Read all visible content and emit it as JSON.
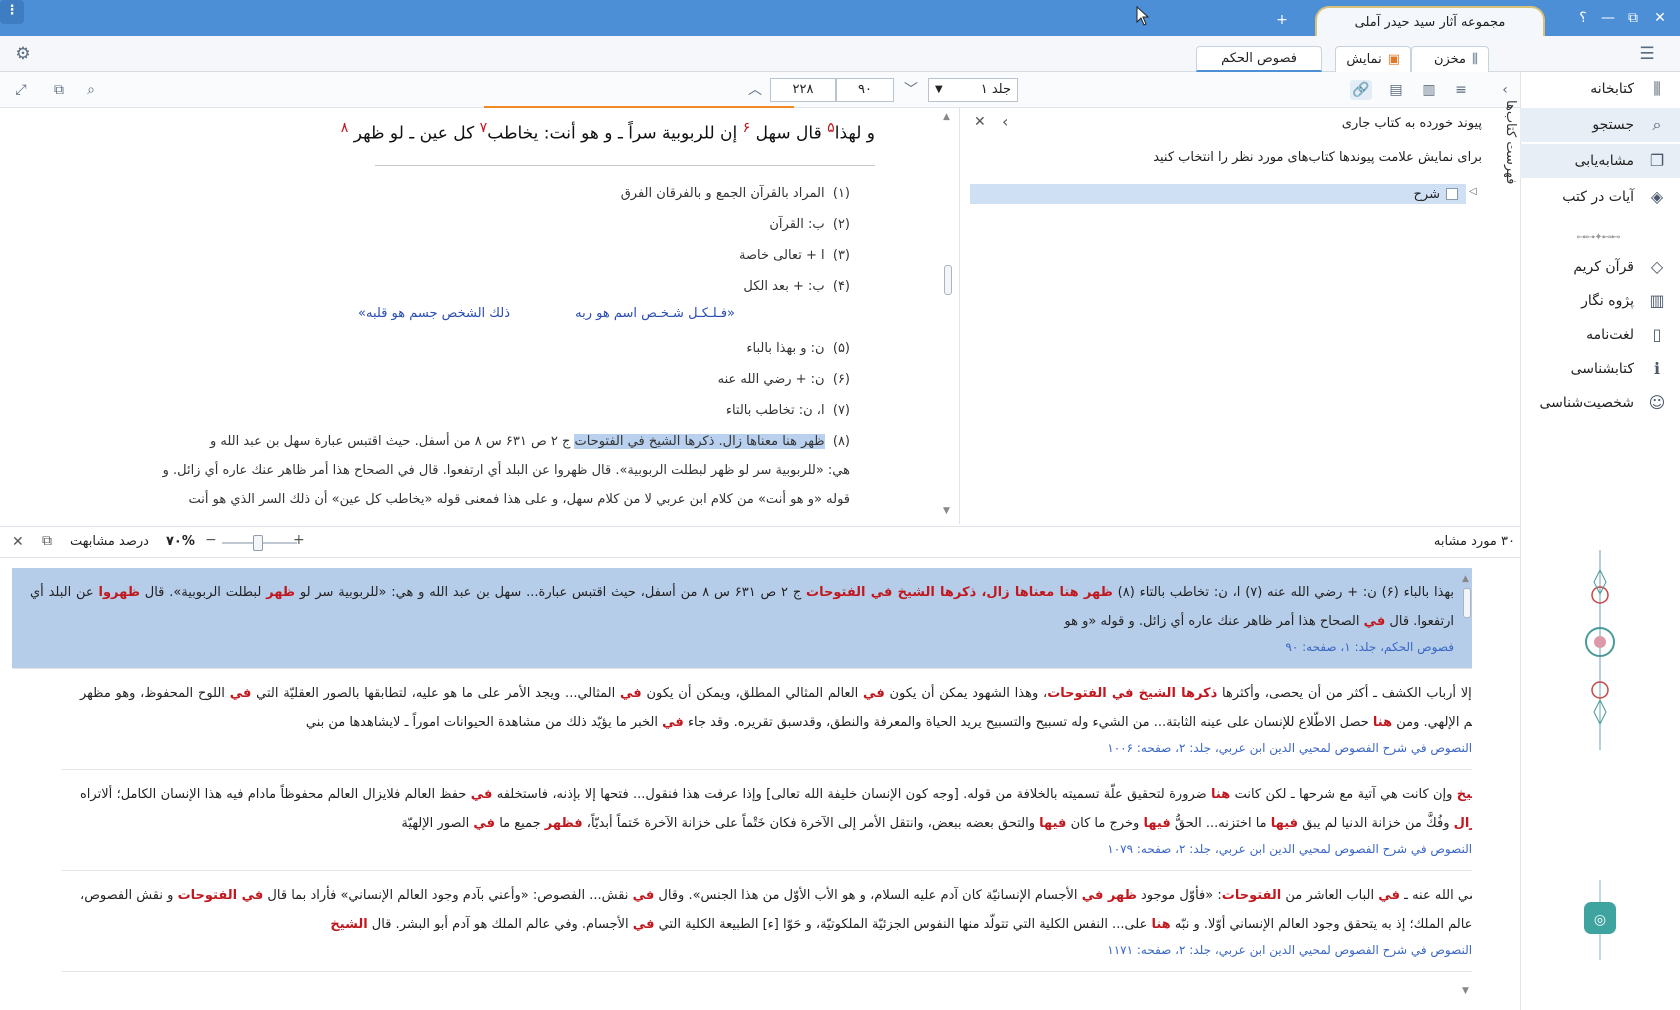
{
  "window": {
    "tab_title": "مجموعه آثار سید حیدر آملی",
    "new_tab": "+",
    "help": "؟",
    "minimize": "—",
    "maximize": "⧉",
    "close": "✕",
    "menu": "⋮"
  },
  "tabs": {
    "store": "مخزن",
    "display": "نمایش",
    "book": "فصوص الحکم"
  },
  "toolbar": {
    "volume": "جلد ۱",
    "page": "۹۰",
    "total": "۲۲۸"
  },
  "sidebar": {
    "items": [
      {
        "label": "کتابخانه",
        "icon": "library-icon"
      },
      {
        "label": "جستجو",
        "icon": "search-icon"
      },
      {
        "label": "مشابه‌یابی",
        "icon": "similar-icon"
      },
      {
        "label": "آیات در کتب",
        "icon": "verses-icon"
      },
      {
        "label": "قرآن کریم",
        "icon": "quran-icon"
      },
      {
        "label": "پژوه نگار",
        "icon": "notebook-icon"
      },
      {
        "label": "لغت‌نامه",
        "icon": "dictionary-icon"
      },
      {
        "label": "کتابشناسی",
        "icon": "bibliography-icon"
      },
      {
        "label": "شخصیت‌شناسی",
        "icon": "person-icon"
      }
    ],
    "vertical_tab": "فهرست کتاب‌ها"
  },
  "reader": {
    "heading": {
      "p1": "و لهذا",
      "n5": "۵",
      "p2": " قال سهل ",
      "n6": "۶",
      "p3": " إن للربوبية سراً ـ و هو أنت: يخاطب",
      "n7": "۷",
      "p4": " كل عين ـ لو ظهر ",
      "n8": "۸"
    },
    "footnotes": [
      {
        "n": "(۱)",
        "t": "المراد بالقرآن الجمع و بالفرقان الفرق"
      },
      {
        "n": "(۲)",
        "t": "ب: القرآن"
      },
      {
        "n": "(۳)",
        "t": "ا + تعالى خاصة"
      },
      {
        "n": "(۴)",
        "t": "ب: + بعد الكل"
      },
      {
        "n": "(۵)",
        "t": "ن: و بهذا بالباء"
      },
      {
        "n": "(۶)",
        "t": "ن: + رضي الله عنه"
      },
      {
        "n": "(۷)",
        "t": "ا، ن: تخاطب بالتاء"
      }
    ],
    "poem": {
      "right": "«فـلـكـل شـخـص اسم هو ربه",
      "left": "ذلك الشخص جسم هو قلبه»"
    },
    "fn8": {
      "n": "(۸)",
      "hl": "ظهر هنا معناها زال. ذكرها الشيخ في الفتوحات",
      "rest": " ج ۲ ص ۶۳۱ س ۸ من أسفل. حيث اقتبس عبارة سهل بن عبد الله و",
      "line2": "هي: «للربوبية سر لو ظهر لبطلت الربوبية». قال ظهروا عن البلد أي ارتفعوا. قال في الصحاح هذا أمر ظاهر عنك عاره أي زائل. و",
      "line3": "قوله «و هو أنت» من كلام ابن عربي لا من كلام سهل، و على هذا فمعنى قوله «يخاطب كل عين» أن ذلك السر الذي هو أنت"
    }
  },
  "linked": {
    "title": "پیوند خورده به کتاب جاری",
    "desc": "برای نمایش علامت پیوندها کتاب‌های مورد نظر را انتخاب کنید",
    "item": "شرح"
  },
  "similarity": {
    "count": "۳۰ مورد مشابه",
    "label": "درصد مشابهت",
    "percent": "۷۰%",
    "percent_value": 70,
    "minus": "−",
    "plus": "+"
  },
  "results": [
    {
      "segments": [
        {
          "t": "بهذا بالباء (۶) ن: + رضي الله عنه (۷) ا، ن: تخاطب بالتاء (۸) ",
          "c": ""
        },
        {
          "t": "ظهر هنا معناها زال، ذكرها الشيخ في الفتوحات",
          "c": "red"
        },
        {
          "t": " ج ۲ ص ۶۳۱ س ۸ من أسفل، حيث اقتبس عبارة... سهل بن عبد الله و هي: «للربوبية سر لو ",
          "c": ""
        },
        {
          "t": "ظهر",
          "c": "red"
        },
        {
          "t": " لبطلت الربوبية». قال ",
          "c": ""
        },
        {
          "t": "ظهروا",
          "c": "red"
        },
        {
          "t": " عن البلد أي ارتفعوا. قال ",
          "c": ""
        },
        {
          "t": "في",
          "c": "red"
        },
        {
          "t": " الصحاح هذا أمر ظاهر عنك عاره أي زائل. و قوله «و هو",
          "c": ""
        }
      ],
      "src": "فصوص الحکم، جلد: ۱، صفحه: ۹۰"
    },
    {
      "segments": [
        {
          "t": "آدم إلا أرباب الكشف ـ أكثر من أن يحصى، وأكثرها ",
          "c": ""
        },
        {
          "t": "ذكرها الشيخ في الفتوحات",
          "c": "red"
        },
        {
          "t": "، وهذا الشهود يمكن أن يكون ",
          "c": ""
        },
        {
          "t": "في",
          "c": "red"
        },
        {
          "t": " العالم المثالي المطلق، ويمكن أن يكون ",
          "c": ""
        },
        {
          "t": "في",
          "c": "red"
        },
        {
          "t": " المثالي... ويجد الأمر على ما هو عليه، لتطابقها بالصور العقليّة التي ",
          "c": ""
        },
        {
          "t": "في",
          "c": "red"
        },
        {
          "t": " اللوح المحفوظ، وهو مظهر العالم الإلهي. ومن ",
          "c": ""
        },
        {
          "t": "هنا",
          "c": "red"
        },
        {
          "t": " حصل الاطّلاع للإنسان على عينه الثابتة... من الشيء وله تسبيح والتسبيح يريد الحياة والمعرفة والنطق، وقدسبق تقريره. وقد جاء ",
          "c": ""
        },
        {
          "t": "في",
          "c": "red"
        },
        {
          "t": " الخبر ما يؤيّد ذلك من مشاهدة الحيوانات اموراً ـ لايشاهدها من بني",
          "c": ""
        }
      ],
      "src": "نص النصوص في شرح الفصوص لمحيي الدين ابن عربي، جلد: ۲، صفحه: ۱۰۰۶"
    },
    {
      "segments": [
        {
          "t": "الشيخ",
          "c": "red"
        },
        {
          "t": " وإن كانت هي آتية مع شرحها ـ لكن كانت ",
          "c": ""
        },
        {
          "t": "هنا",
          "c": "red"
        },
        {
          "t": " ضرورة لتحقيق علّة تسميته بالخلافة من قوله. [وجه كون الإنسان خليفة الله تعالى] وإذا عرفت هذا فنقول... فتحها إلا بإذنه، فاستخلفه ",
          "c": ""
        },
        {
          "t": "في",
          "c": "red"
        },
        {
          "t": " حفظ العالم فلايزال العالم محفوظاً مادام فيه هذا الإنسان الكامل؛ ألاتراه إذا ",
          "c": ""
        },
        {
          "t": "زال",
          "c": "red"
        },
        {
          "t": " وفُكَّ من خزانة الدنيا لم يبق ",
          "c": ""
        },
        {
          "t": "فيها",
          "c": "red"
        },
        {
          "t": " ما اختزنه... الحقُّ ",
          "c": ""
        },
        {
          "t": "فيها",
          "c": "red"
        },
        {
          "t": " وخرج ما كان ",
          "c": ""
        },
        {
          "t": "فيها",
          "c": "red"
        },
        {
          "t": " والتحق بعضه ببعض، وانتقل الأمر إلى الآخرة فكان خَتْماً على خزانة الآخرة خَتماً أبديّاً، ",
          "c": ""
        },
        {
          "t": "فظهر",
          "c": "red"
        },
        {
          "t": " جميع ما ",
          "c": ""
        },
        {
          "t": "في",
          "c": "red"
        },
        {
          "t": " الصور الإلهيّة",
          "c": ""
        }
      ],
      "src": "نص النصوص في شرح الفصوص لمحيي الدين ابن عربي، جلد: ۲، صفحه: ۱۰۷۹"
    },
    {
      "segments": [
        {
          "t": "ـ رضي الله عنه ـ ",
          "c": ""
        },
        {
          "t": "في",
          "c": "red"
        },
        {
          "t": " الباب العاشر من ",
          "c": ""
        },
        {
          "t": "الفتوحات",
          "c": "red"
        },
        {
          "t": ": «فأوّل موجود ",
          "c": ""
        },
        {
          "t": "ظهر في",
          "c": "red"
        },
        {
          "t": " الأجسام الإنسانيّة كان آدم عليه السلام، و هو الأب الأوّل من هذا الجنس». وقال ",
          "c": ""
        },
        {
          "t": "في",
          "c": "red"
        },
        {
          "t": " نقش... الفصوص: «وأعني بآدم وجود العالم الإنساني» فأراد بما قال ",
          "c": ""
        },
        {
          "t": "في الفتوحات",
          "c": "red"
        },
        {
          "t": " و نقش الفصوص، آدم عالم الملك؛ إذ به يتحقق وجود العالم الإنساني أوّلا. و نبّه ",
          "c": ""
        },
        {
          "t": "هنا",
          "c": "red"
        },
        {
          "t": " على... النفس الكلية التي تتولّد منها النفوس الجزئيّة الملكوتيّة، و حَوّا [ء] الطبيعة الكلية التي ",
          "c": ""
        },
        {
          "t": "في",
          "c": "red"
        },
        {
          "t": " الأجسام. وفي عالم الملك هو آدم أبو البشر. قال ",
          "c": ""
        },
        {
          "t": "الشيخ",
          "c": "red"
        }
      ],
      "src": "نص النصوص في شرح الفصوص لمحيي الدين ابن عربي، جلد: ۲، صفحه: ۱۱۷۱"
    }
  ],
  "colors": {
    "titlebar": "#4d8fd6",
    "highlight": "#b6cdea",
    "match": "#c0181e",
    "source": "#3b67c4",
    "orange_accent": "#f08a24"
  }
}
